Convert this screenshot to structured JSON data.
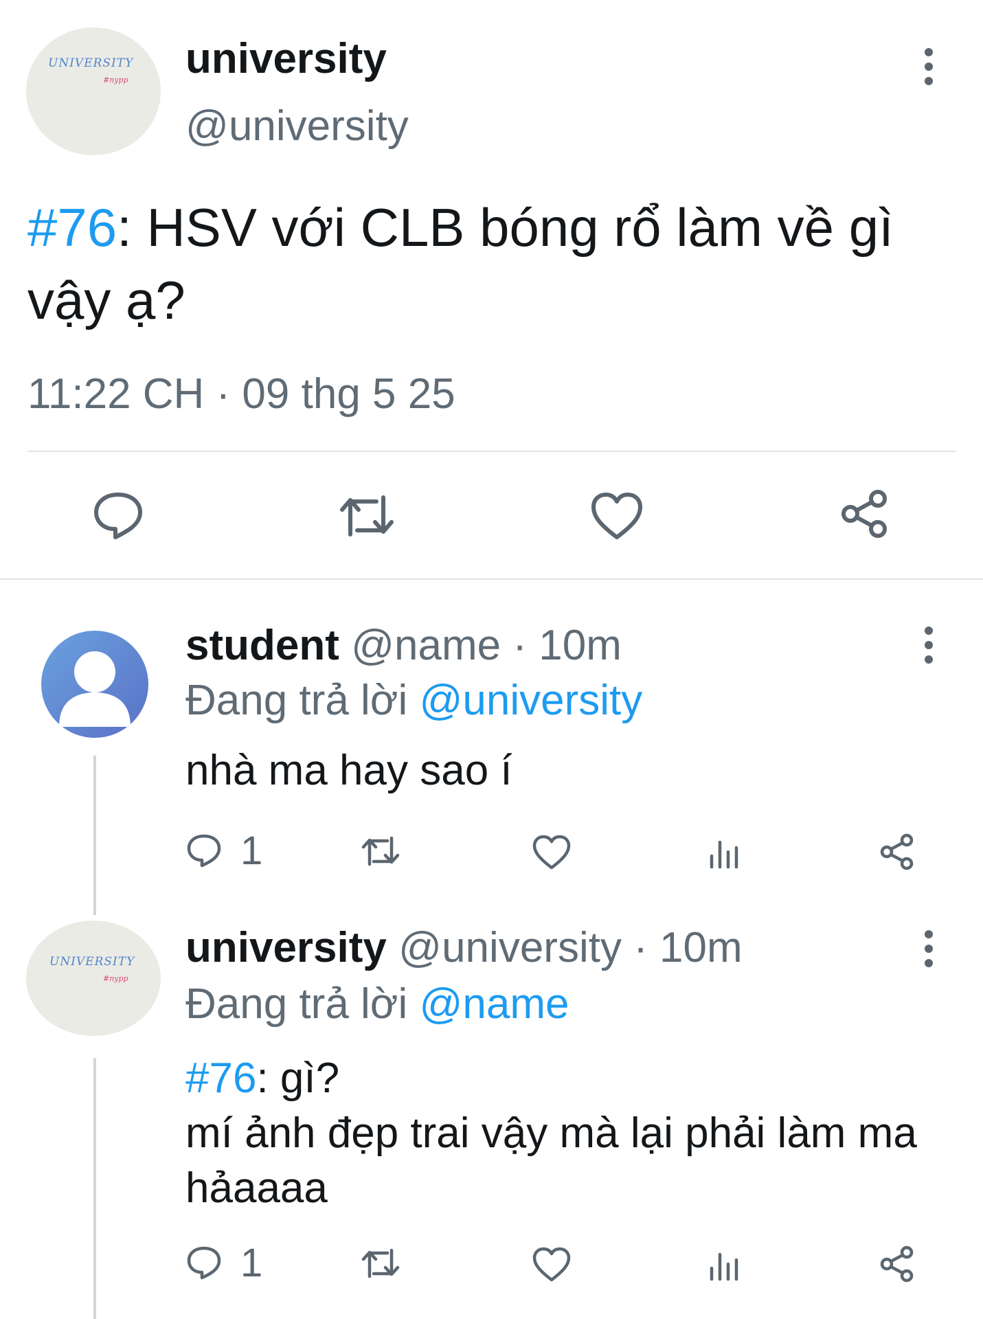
{
  "main_tweet": {
    "display_name": "university",
    "handle": "@university",
    "avatar_text": "UNIVERSITY",
    "avatar_sub": "#nypp",
    "hashtag": "#76",
    "text": ": HSV với CLB bóng rổ làm về gì vậy ạ?",
    "timestamp": "11:22 CH · 09 thg 5 25"
  },
  "replies": [
    {
      "display_name": "student",
      "handle": "@name",
      "time": "· 10m",
      "replying_prefix": "Đang trả lời ",
      "replying_to": "@university",
      "text": "nhà ma hay sao í",
      "reply_count": "1"
    },
    {
      "display_name": "university",
      "handle": "@university",
      "time": "· 10m",
      "replying_prefix": "Đang trả lời ",
      "replying_to": "@name",
      "hashtag": "#76",
      "text_line1": ": gì?",
      "text_rest": "mí ảnh đẹp trai vậy mà lại phải làm ma hảaaaa",
      "reply_count": "1",
      "avatar_text": "UNIVERSITY",
      "avatar_sub": "#nypp"
    }
  ],
  "icons": {
    "reply": "speech-bubble-icon",
    "retweet": "retweet-icon",
    "like": "heart-icon",
    "views": "bar-chart-icon",
    "share": "share-icon",
    "more": "more-vertical-icon"
  },
  "colors": {
    "accent": "#1d9bf0",
    "secondary_text": "#5f6b75",
    "icon": "#5b6670",
    "divider": "#e1e6ea"
  }
}
